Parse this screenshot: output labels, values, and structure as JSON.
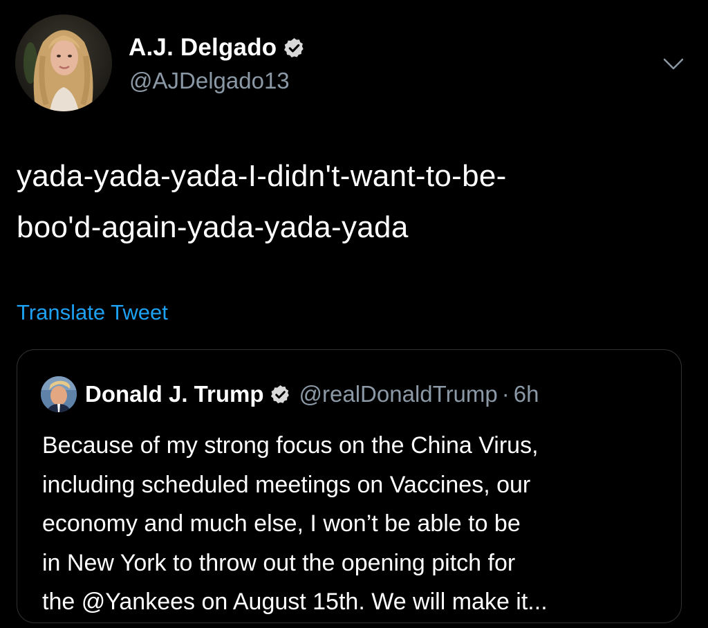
{
  "tweet": {
    "author_name": "A.J. Delgado",
    "author_handle": "@AJDelgado13",
    "text_lines": [
      "yada-yada-yada-I-didn't-want-to-be-",
      "boo'd-again-yada-yada-yada"
    ],
    "translate_label": "Translate Tweet"
  },
  "quoted": {
    "author_name": "Donald J. Trump",
    "author_handle": "@realDonaldTrump",
    "separator": "·",
    "time": "6h",
    "text_lines": [
      "Because of my strong focus on the China Virus,",
      "including scheduled meetings on Vaccines, our",
      "economy and much else, I won’t be able to be",
      "in New York to throw out the opening pitch for",
      "the @Yankees on August 15th. We will make it..."
    ]
  },
  "icons": {
    "verified": "verified-badge-icon",
    "menu": "chevron-down-icon"
  },
  "colors": {
    "background": "#000000",
    "text": "#ffffff",
    "secondary": "#8b98a5",
    "link": "#1da1f2",
    "border": "#2f3336"
  }
}
